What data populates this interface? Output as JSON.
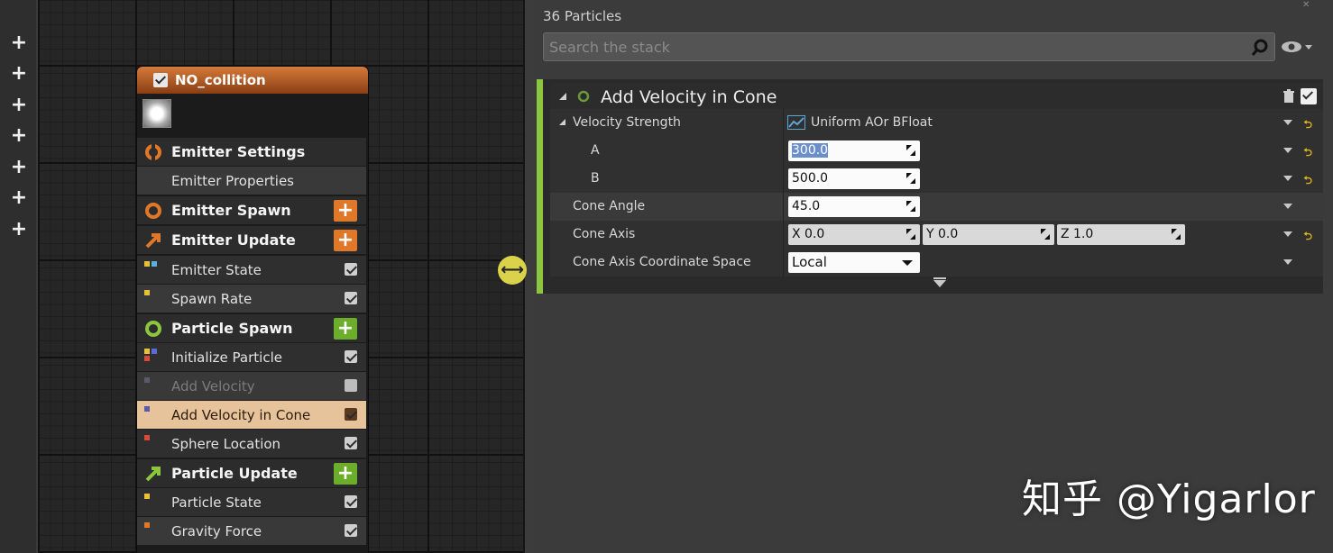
{
  "toolbar": {
    "add_buttons": [
      "+",
      "+",
      "+",
      "+",
      "+",
      "+",
      "+"
    ]
  },
  "node": {
    "title": "NO_collition",
    "enabled": true,
    "rows": [
      {
        "type": "group",
        "label": "Emitter Settings",
        "icon": "emitter-settings-icon",
        "color": "#e0782a"
      },
      {
        "type": "item",
        "label": "Emitter Properties"
      },
      {
        "type": "group",
        "label": "Emitter Spawn",
        "icon": "emitter-spawn-icon",
        "color": "#e0782a",
        "add": "+"
      },
      {
        "type": "group",
        "label": "Emitter Update",
        "icon": "emitter-update-icon",
        "color": "#e0782a",
        "add": "+"
      },
      {
        "type": "item",
        "label": "Emitter State",
        "checked": true
      },
      {
        "type": "item",
        "label": "Spawn Rate",
        "checked": true
      },
      {
        "type": "group",
        "label": "Particle Spawn",
        "icon": "particle-spawn-icon",
        "color": "#8cc63f",
        "add": "+"
      },
      {
        "type": "item",
        "label": "Initialize Particle",
        "checked": true
      },
      {
        "type": "item",
        "label": "Add Velocity",
        "checked": false,
        "disabled": true
      },
      {
        "type": "item",
        "label": "Add Velocity in Cone",
        "checked": true,
        "selected": true
      },
      {
        "type": "item",
        "label": "Sphere Location",
        "checked": true
      },
      {
        "type": "group",
        "label": "Particle Update",
        "icon": "particle-update-icon",
        "color": "#8cc63f",
        "add": "+"
      },
      {
        "type": "item",
        "label": "Particle State",
        "checked": true
      },
      {
        "type": "item",
        "label": "Gravity Force",
        "checked": true
      }
    ]
  },
  "panel": {
    "particles_label": "36 Particles",
    "search_placeholder": "Search the stack",
    "module": {
      "title": "Add Velocity in Cone",
      "enabled": true,
      "velocity_strength_label": "Velocity Strength",
      "velocity_strength_type": "Uniform AOr BFloat",
      "a_label": "A",
      "a_value": "300.0",
      "b_label": "B",
      "b_value": "500.0",
      "cone_angle_label": "Cone Angle",
      "cone_angle_value": "45.0",
      "cone_axis_label": "Cone Axis",
      "cone_axis_x": "X  0.0",
      "cone_axis_y": "Y  0.0",
      "cone_axis_z": "Z  1.0",
      "coord_space_label": "Cone Axis Coordinate Space",
      "coord_space_value": "Local",
      "reset_symbol": "⮌"
    }
  },
  "watermark": "知乎 @Yigarlor",
  "colors": {
    "accent_green": "#8cc63f",
    "accent_orange": "#e0782a",
    "selected_row": "#e6c39a",
    "reset": "#e0b51a"
  }
}
